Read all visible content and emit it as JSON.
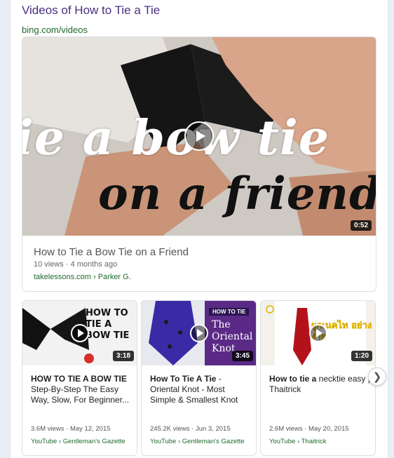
{
  "header": {
    "title": "Videos of How to Tie a Tie",
    "source": "bing.com/videos"
  },
  "main_video": {
    "overlay_line1": "ie a bow tie",
    "overlay_line2": "on a friend",
    "duration": "0:52",
    "title": "How to Tie a Bow Tie on a Friend",
    "meta": "10 views · 4 months ago",
    "source": "takelessons.com › Parker G."
  },
  "videos": [
    {
      "thumb_text": "HOW TO TIE A BOW TIE",
      "duration": "3:18",
      "title_bold": "HOW TO TIE A BOW TIE",
      "title_rest": "Step-By-Step The Easy Way, Slow, For Beginner...",
      "meta": "3.6M views · May 12, 2015",
      "source": "YouTube › Gentleman's Gazette"
    },
    {
      "thumb_label": "HOW TO TIE",
      "thumb_text": "The Oriental Knot",
      "duration": "3:45",
      "title_bold": "How To Tie A Tie",
      "title_rest": " - Oriental Knot - Most Simple & Smallest Knot",
      "meta": "245.2K views · Jun 3, 2015",
      "source": "YouTube › Gentleman's Gazette"
    },
    {
      "thumb_text": "ผูกเนคไท อย่างง่าย",
      "duration": "1:20",
      "title_bold": "How to tie a",
      "title_rest": " necktie easy | Thaitrick",
      "meta": "2.6M views · May 20, 2015",
      "source": "YouTube › Thaitrick"
    }
  ],
  "colors": {
    "title": "#4b2e83",
    "source_green": "#1e6b2c",
    "purple_banner": "#5a2a86"
  },
  "icons": [
    "play-icon",
    "chevron-right-icon"
  ]
}
